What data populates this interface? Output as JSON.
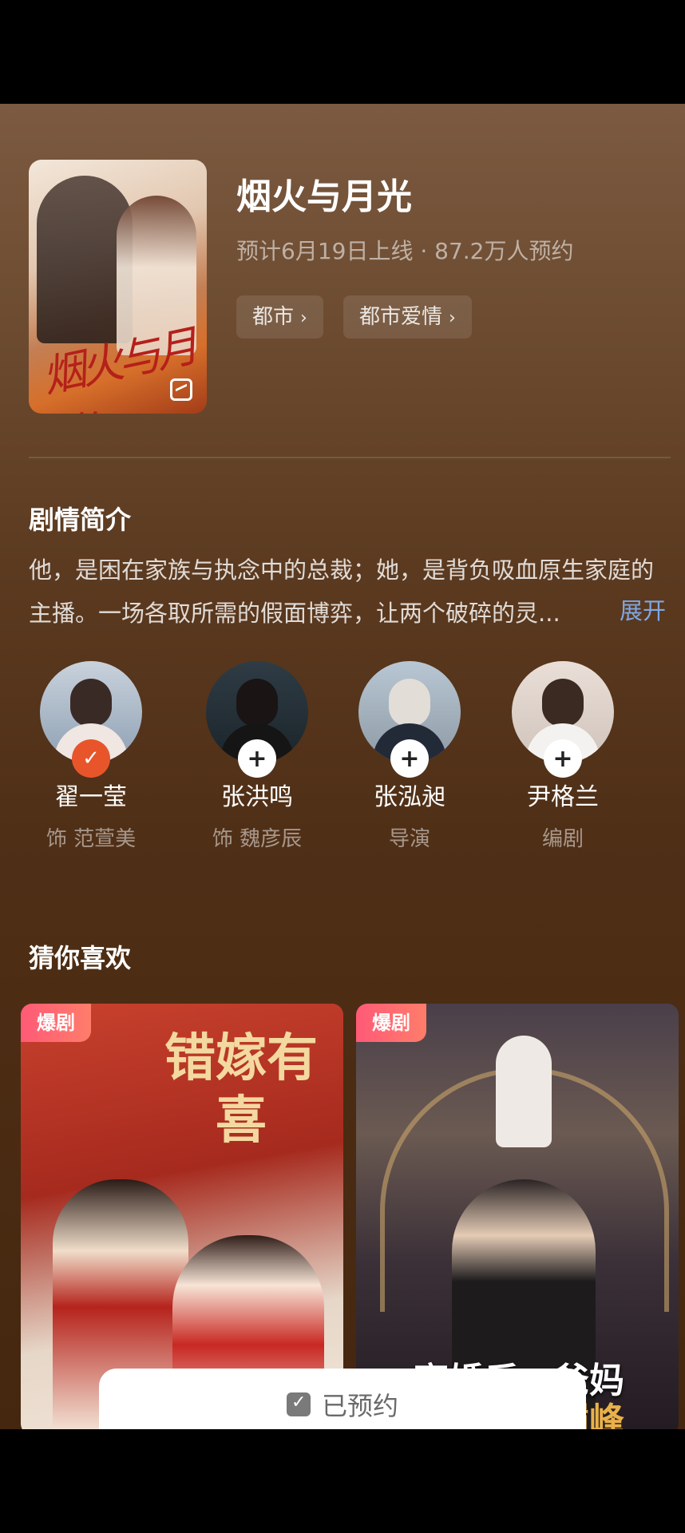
{
  "show": {
    "title": "烟火与月光",
    "meta": "预计6月19日上线 · 87.2万人预约",
    "poster_text": "烟火与月光",
    "tags": [
      {
        "label": "都市",
        "chevron": "›"
      },
      {
        "label": "都市爱情",
        "chevron": "›"
      }
    ]
  },
  "synopsis": {
    "title": "剧情简介",
    "text": "他，是困在家族与执念中的总裁；她，是背负吸血原生家庭的主播。一场各取所需的假面博弈，让两个破碎的灵...",
    "expand": "展开"
  },
  "people": [
    {
      "name": "翟一莹",
      "role": "饰 范萱美",
      "followed": true,
      "badge": "✓"
    },
    {
      "name": "张洪鸣",
      "role": "饰 魏彦辰",
      "followed": false,
      "badge": "+"
    },
    {
      "name": "张泓昶",
      "role": "导演",
      "followed": false,
      "badge": "+"
    },
    {
      "name": "尹格兰",
      "role": "编剧",
      "followed": false,
      "badge": "+"
    }
  ],
  "recommend": {
    "title": "猜你喜欢",
    "cards": [
      {
        "badge": "爆剧",
        "poster_title": "错嫁有喜"
      },
      {
        "badge": "爆剧",
        "poster_title": "离婚后，爸妈",
        "poster_title_2": "带我走上巅峰"
      }
    ]
  },
  "reserve_button": {
    "label": "已预约",
    "icon": "calendar-check-icon"
  },
  "colors": {
    "accent": "#e8552b",
    "link": "#7fa7e2",
    "badge_gradient": [
      "#ff5a77",
      "#ff7d6a"
    ]
  }
}
